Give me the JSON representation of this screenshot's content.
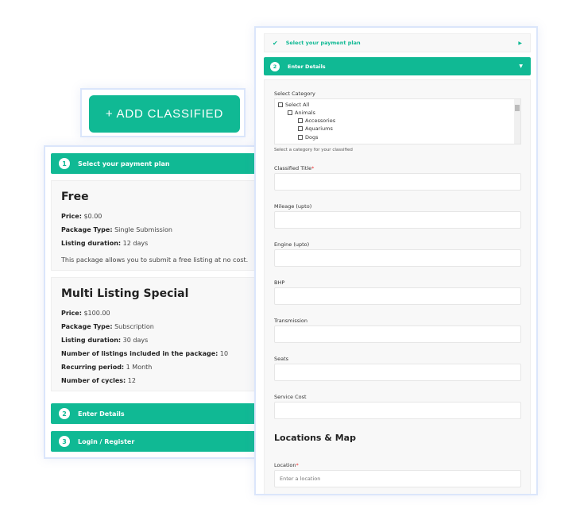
{
  "add_button": {
    "label": "+ ADD CLASSIFIED"
  },
  "left": {
    "steps": [
      {
        "num": "1",
        "label": "Select your payment plan"
      },
      {
        "num": "2",
        "label": "Enter Details"
      },
      {
        "num": "3",
        "label": "Login / Register"
      }
    ],
    "plans": [
      {
        "title": "Free",
        "rows": [
          [
            "Price:",
            "$0.00"
          ],
          [
            "Package Type:",
            "Single Submission"
          ],
          [
            "Listing duration:",
            "12 days"
          ]
        ],
        "description": "This package allows you to submit a free listing at no cost."
      },
      {
        "title": "Multi Listing Special",
        "rows": [
          [
            "Price:",
            "$100.00"
          ],
          [
            "Package Type:",
            "Subscription"
          ],
          [
            "Listing duration:",
            "30 days"
          ],
          [
            "Number of listings included in the package:",
            "10"
          ],
          [
            "Recurring period:",
            "1 Month"
          ],
          [
            "Number of cycles:",
            "12"
          ]
        ]
      }
    ]
  },
  "right": {
    "step1": {
      "label": "Select your payment plan",
      "icon": "check-icon"
    },
    "step2": {
      "num": "2",
      "label": "Enter Details"
    },
    "category": {
      "label": "Select Category",
      "items": [
        "Select All",
        "Animals",
        "Accessories",
        "Aquariums",
        "Dogs"
      ],
      "help": "Select a category for your classified"
    },
    "fields": [
      {
        "label": "Classified Title",
        "required": "*"
      },
      {
        "label": "Mileage (upto)"
      },
      {
        "label": "Engine (upto)"
      },
      {
        "label": "BHP"
      },
      {
        "label": "Transmission"
      },
      {
        "label": "Seats"
      },
      {
        "label": "Service Cost"
      }
    ],
    "section_title": "Locations & Map",
    "location": {
      "label": "Location",
      "required": "*",
      "placeholder": "Enter a location"
    }
  },
  "colors": {
    "accent": "#10b994",
    "frame": "#dbe6fb"
  }
}
